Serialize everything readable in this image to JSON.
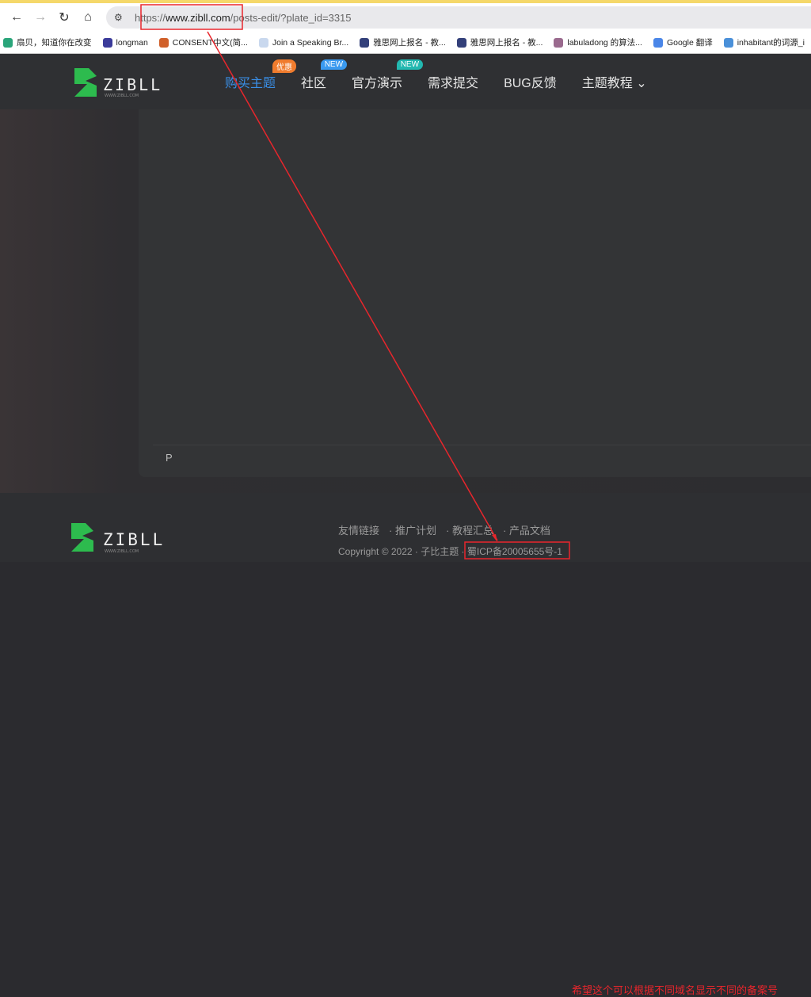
{
  "browser": {
    "url_prefix": "https://",
    "url_domain": "www.zibll.com",
    "url_path": "/posts-edit/?plate_id=3315",
    "bookmarks": [
      {
        "label": "扇贝，知道你在改变",
        "color": "#2aa57a"
      },
      {
        "label": "longman",
        "color": "#3b3b9a"
      },
      {
        "label": "CONSENT中文(简...",
        "color": "#d0602a"
      },
      {
        "label": "Join a Speaking Br...",
        "color": "#c9d8ee"
      },
      {
        "label": "雅思网上报名 - 教...",
        "color": "#33407a"
      },
      {
        "label": "雅思网上报名 - 教...",
        "color": "#33407a"
      },
      {
        "label": "labuladong 的算法...",
        "color": "#9a6a8e"
      },
      {
        "label": "Google 翻译",
        "color": "#4a86e8"
      },
      {
        "label": "inhabitant的词源_i",
        "color": "#4a90d9"
      }
    ]
  },
  "nav": {
    "items": [
      {
        "label": "购买主题",
        "badge": "优惠",
        "badge_color": "#f07c2e",
        "active": true
      },
      {
        "label": "社区",
        "badge": "NEW",
        "badge_color": "#3a9af0"
      },
      {
        "label": "官方演示",
        "badge": "NEW",
        "badge_color": "#22b8b0"
      },
      {
        "label": "需求提交"
      },
      {
        "label": "BUG反馈"
      },
      {
        "label": "主题教程",
        "dropdown": "⌄"
      }
    ]
  },
  "editor": {
    "path": "P"
  },
  "footer": {
    "links": [
      "友情链接",
      "推广计划",
      "教程汇总",
      "产品文档"
    ],
    "copyright": "Copyright © 2022 · 子比主题 ·",
    "icp": "蜀ICP备20005655号-1"
  },
  "annotation": {
    "text": "希望这个可以根据不同域名显示不同的备案号",
    "color": "#e8262c"
  },
  "colors": {
    "accent": "#3a8ee6",
    "logo_green": "#2dbb4e"
  }
}
